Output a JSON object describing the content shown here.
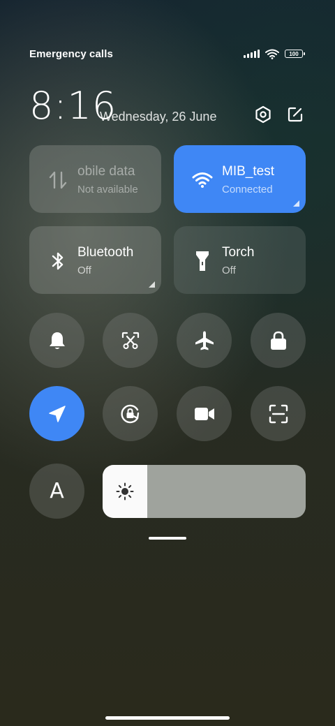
{
  "status_bar": {
    "left_text": "Emergency calls o",
    "battery": "100"
  },
  "header": {
    "time": "8:16",
    "date": "Wednesday, 26 June"
  },
  "tiles": {
    "mobile_data": {
      "title": "obile data",
      "subtitle": "Not available"
    },
    "wifi": {
      "title": "MIB_test",
      "subtitle": "Connected"
    },
    "bluetooth": {
      "title": "Bluetooth",
      "subtitle": "Off"
    },
    "torch": {
      "title": "Torch",
      "subtitle": "Off"
    }
  },
  "toggles_row1": [
    "bell-icon",
    "screenshot-icon",
    "airplane-icon",
    "lock-icon"
  ],
  "toggles_row2": [
    "location-icon",
    "rotation-lock-icon",
    "video-icon",
    "scanner-icon"
  ],
  "font_toggle": {
    "letter": "A"
  },
  "brightness": {
    "level": 0.22
  },
  "colors": {
    "accent": "#3f87f5"
  }
}
